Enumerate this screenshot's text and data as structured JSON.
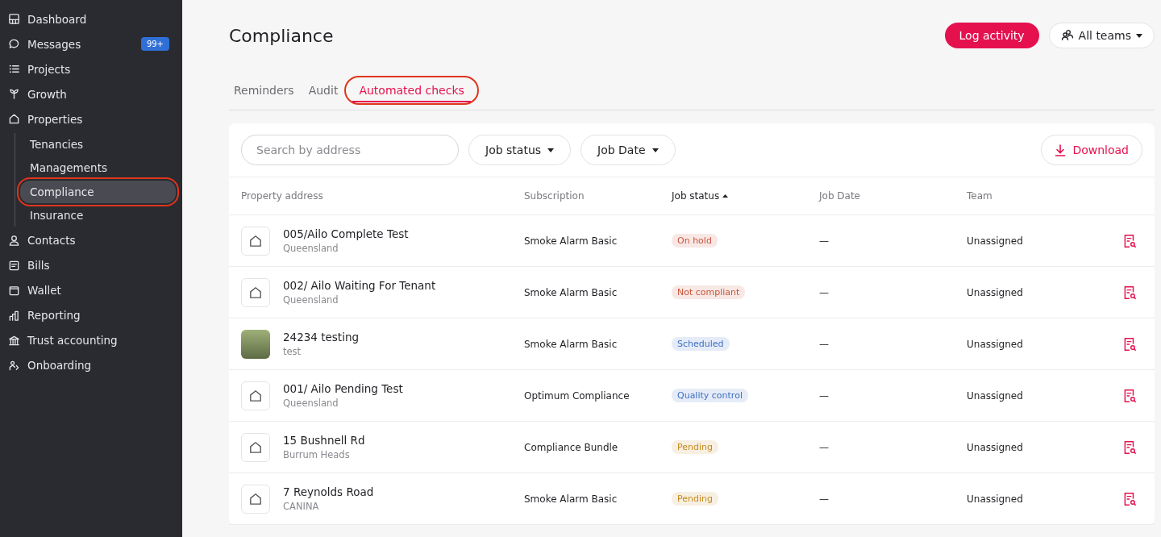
{
  "sidebar": {
    "items": [
      {
        "label": "Dashboard",
        "selected": false
      },
      {
        "label": "Messages",
        "selected": false,
        "badge": "99+"
      },
      {
        "label": "Projects",
        "selected": false
      },
      {
        "label": "Growth",
        "selected": false
      },
      {
        "label": "Properties",
        "selected": false,
        "expanded": true,
        "children": [
          {
            "label": "Tenancies",
            "selected": false,
            "highlighted": false
          },
          {
            "label": "Managements",
            "selected": false,
            "highlighted": false
          },
          {
            "label": "Compliance",
            "selected": true,
            "highlighted": true
          },
          {
            "label": "Insurance",
            "selected": false,
            "highlighted": false
          }
        ]
      },
      {
        "label": "Contacts",
        "selected": false
      },
      {
        "label": "Bills",
        "selected": false
      },
      {
        "label": "Wallet",
        "selected": false
      },
      {
        "label": "Reporting",
        "selected": false
      },
      {
        "label": "Trust accounting",
        "selected": false
      },
      {
        "label": "Onboarding",
        "selected": false
      }
    ]
  },
  "page": {
    "title": "Compliance",
    "primary_action": "Log activity",
    "team_filter": "All teams"
  },
  "tabs": [
    {
      "label": "Reminders",
      "selected": false,
      "highlighted": false
    },
    {
      "label": "Audit",
      "selected": false,
      "highlighted": false
    },
    {
      "label": "Automated checks",
      "selected": true,
      "highlighted": true
    }
  ],
  "toolbar": {
    "search": {
      "placeholder": "Search by address"
    },
    "filters": [
      "Job status",
      "Job Date"
    ],
    "download": "Download"
  },
  "table": {
    "columns": [
      {
        "label": "Property address",
        "sorted": false
      },
      {
        "label": "Subscription",
        "sorted": false
      },
      {
        "label": "Job status",
        "sorted": true
      },
      {
        "label": "Job Date",
        "sorted": false
      },
      {
        "label": "Team",
        "sorted": false
      }
    ],
    "rows": [
      {
        "kind": "house",
        "address": "005/Ailo Complete Test",
        "region": "Queensland",
        "subscription": "Smoke Alarm Basic",
        "status": "On hold",
        "color": "#c8553d",
        "job_date": "—",
        "team": "Unassigned"
      },
      {
        "kind": "house",
        "address": "002/ Ailo Waiting For Tenant",
        "region": "Queensland",
        "subscription": "Smoke Alarm Basic",
        "status": "Not compliant",
        "color": "#c8553d",
        "job_date": "—",
        "team": "Unassigned"
      },
      {
        "kind": "photo",
        "address": "24234 testing",
        "region": "test",
        "subscription": "Smoke Alarm Basic",
        "status": "Scheduled",
        "color": "#3f6fc4",
        "job_date": "—",
        "team": "Unassigned"
      },
      {
        "kind": "house",
        "address": "001/ Ailo Pending Test",
        "region": "Queensland",
        "subscription": "Optimum Compliance",
        "status": "Quality control",
        "color": "#3f6fc4",
        "job_date": "—",
        "team": "Unassigned"
      },
      {
        "kind": "house",
        "address": "15 Bushnell Rd",
        "region": "Burrum Heads",
        "subscription": "Compliance Bundle",
        "status": "Pending",
        "color": "#c48a1e",
        "job_date": "—",
        "team": "Unassigned"
      },
      {
        "kind": "house",
        "address": "7 Reynolds Road",
        "region": "CANINA",
        "subscription": "Smoke Alarm Basic",
        "status": "Pending",
        "color": "#c48a1e",
        "job_date": "—",
        "team": "Unassigned"
      }
    ]
  }
}
